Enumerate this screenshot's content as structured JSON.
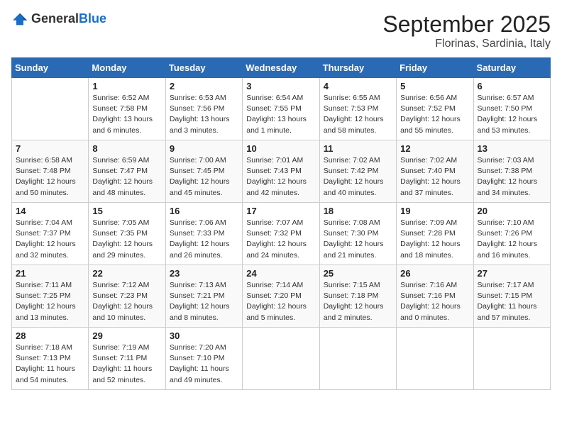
{
  "logo": {
    "general": "General",
    "blue": "Blue"
  },
  "header": {
    "month": "September 2025",
    "location": "Florinas, Sardinia, Italy"
  },
  "weekdays": [
    "Sunday",
    "Monday",
    "Tuesday",
    "Wednesday",
    "Thursday",
    "Friday",
    "Saturday"
  ],
  "weeks": [
    [
      {
        "day": "",
        "info": ""
      },
      {
        "day": "1",
        "info": "Sunrise: 6:52 AM\nSunset: 7:58 PM\nDaylight: 13 hours\nand 6 minutes."
      },
      {
        "day": "2",
        "info": "Sunrise: 6:53 AM\nSunset: 7:56 PM\nDaylight: 13 hours\nand 3 minutes."
      },
      {
        "day": "3",
        "info": "Sunrise: 6:54 AM\nSunset: 7:55 PM\nDaylight: 13 hours\nand 1 minute."
      },
      {
        "day": "4",
        "info": "Sunrise: 6:55 AM\nSunset: 7:53 PM\nDaylight: 12 hours\nand 58 minutes."
      },
      {
        "day": "5",
        "info": "Sunrise: 6:56 AM\nSunset: 7:52 PM\nDaylight: 12 hours\nand 55 minutes."
      },
      {
        "day": "6",
        "info": "Sunrise: 6:57 AM\nSunset: 7:50 PM\nDaylight: 12 hours\nand 53 minutes."
      }
    ],
    [
      {
        "day": "7",
        "info": "Sunrise: 6:58 AM\nSunset: 7:48 PM\nDaylight: 12 hours\nand 50 minutes."
      },
      {
        "day": "8",
        "info": "Sunrise: 6:59 AM\nSunset: 7:47 PM\nDaylight: 12 hours\nand 48 minutes."
      },
      {
        "day": "9",
        "info": "Sunrise: 7:00 AM\nSunset: 7:45 PM\nDaylight: 12 hours\nand 45 minutes."
      },
      {
        "day": "10",
        "info": "Sunrise: 7:01 AM\nSunset: 7:43 PM\nDaylight: 12 hours\nand 42 minutes."
      },
      {
        "day": "11",
        "info": "Sunrise: 7:02 AM\nSunset: 7:42 PM\nDaylight: 12 hours\nand 40 minutes."
      },
      {
        "day": "12",
        "info": "Sunrise: 7:02 AM\nSunset: 7:40 PM\nDaylight: 12 hours\nand 37 minutes."
      },
      {
        "day": "13",
        "info": "Sunrise: 7:03 AM\nSunset: 7:38 PM\nDaylight: 12 hours\nand 34 minutes."
      }
    ],
    [
      {
        "day": "14",
        "info": "Sunrise: 7:04 AM\nSunset: 7:37 PM\nDaylight: 12 hours\nand 32 minutes."
      },
      {
        "day": "15",
        "info": "Sunrise: 7:05 AM\nSunset: 7:35 PM\nDaylight: 12 hours\nand 29 minutes."
      },
      {
        "day": "16",
        "info": "Sunrise: 7:06 AM\nSunset: 7:33 PM\nDaylight: 12 hours\nand 26 minutes."
      },
      {
        "day": "17",
        "info": "Sunrise: 7:07 AM\nSunset: 7:32 PM\nDaylight: 12 hours\nand 24 minutes."
      },
      {
        "day": "18",
        "info": "Sunrise: 7:08 AM\nSunset: 7:30 PM\nDaylight: 12 hours\nand 21 minutes."
      },
      {
        "day": "19",
        "info": "Sunrise: 7:09 AM\nSunset: 7:28 PM\nDaylight: 12 hours\nand 18 minutes."
      },
      {
        "day": "20",
        "info": "Sunrise: 7:10 AM\nSunset: 7:26 PM\nDaylight: 12 hours\nand 16 minutes."
      }
    ],
    [
      {
        "day": "21",
        "info": "Sunrise: 7:11 AM\nSunset: 7:25 PM\nDaylight: 12 hours\nand 13 minutes."
      },
      {
        "day": "22",
        "info": "Sunrise: 7:12 AM\nSunset: 7:23 PM\nDaylight: 12 hours\nand 10 minutes."
      },
      {
        "day": "23",
        "info": "Sunrise: 7:13 AM\nSunset: 7:21 PM\nDaylight: 12 hours\nand 8 minutes."
      },
      {
        "day": "24",
        "info": "Sunrise: 7:14 AM\nSunset: 7:20 PM\nDaylight: 12 hours\nand 5 minutes."
      },
      {
        "day": "25",
        "info": "Sunrise: 7:15 AM\nSunset: 7:18 PM\nDaylight: 12 hours\nand 2 minutes."
      },
      {
        "day": "26",
        "info": "Sunrise: 7:16 AM\nSunset: 7:16 PM\nDaylight: 12 hours\nand 0 minutes."
      },
      {
        "day": "27",
        "info": "Sunrise: 7:17 AM\nSunset: 7:15 PM\nDaylight: 11 hours\nand 57 minutes."
      }
    ],
    [
      {
        "day": "28",
        "info": "Sunrise: 7:18 AM\nSunset: 7:13 PM\nDaylight: 11 hours\nand 54 minutes."
      },
      {
        "day": "29",
        "info": "Sunrise: 7:19 AM\nSunset: 7:11 PM\nDaylight: 11 hours\nand 52 minutes."
      },
      {
        "day": "30",
        "info": "Sunrise: 7:20 AM\nSunset: 7:10 PM\nDaylight: 11 hours\nand 49 minutes."
      },
      {
        "day": "",
        "info": ""
      },
      {
        "day": "",
        "info": ""
      },
      {
        "day": "",
        "info": ""
      },
      {
        "day": "",
        "info": ""
      }
    ]
  ]
}
